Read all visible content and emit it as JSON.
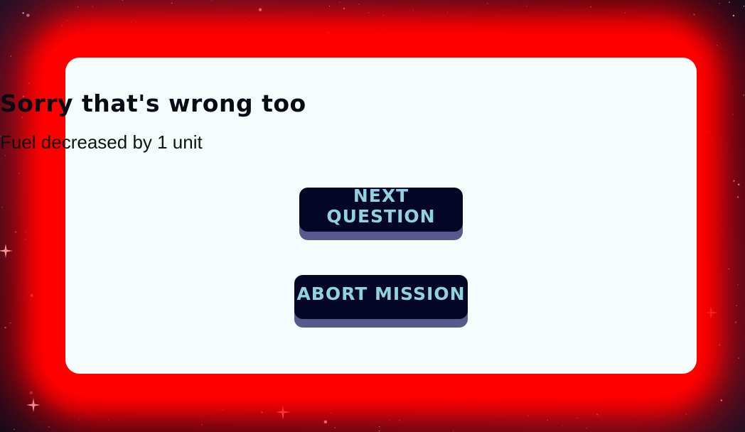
{
  "dialog": {
    "title": "Sorry that's wrong too",
    "message": "Fuel decreased by 1 unit",
    "next_label": "NEXT QUESTION",
    "abort_label": "ABORT MISSION"
  },
  "colors": {
    "glow": "#ff0000",
    "panel": "#f5fdfd",
    "button_bg": "#030624",
    "button_text": "#8fd3e3",
    "button_shadow": "#57588c",
    "space": "#0c0b1e"
  }
}
